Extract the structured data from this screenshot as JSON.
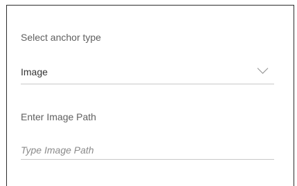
{
  "anchor_type": {
    "label": "Select anchor type",
    "selected_value": "Image",
    "chevron_icon": "chevron-down-icon"
  },
  "image_path": {
    "label": "Enter Image Path",
    "value": "",
    "placeholder": "Type Image Path"
  },
  "colors": {
    "border": "#2b2b2b",
    "underline": "#c8c8c8",
    "label_text": "#5f5f5f",
    "value_text": "#333333",
    "placeholder_text": "#8a8a8a"
  }
}
